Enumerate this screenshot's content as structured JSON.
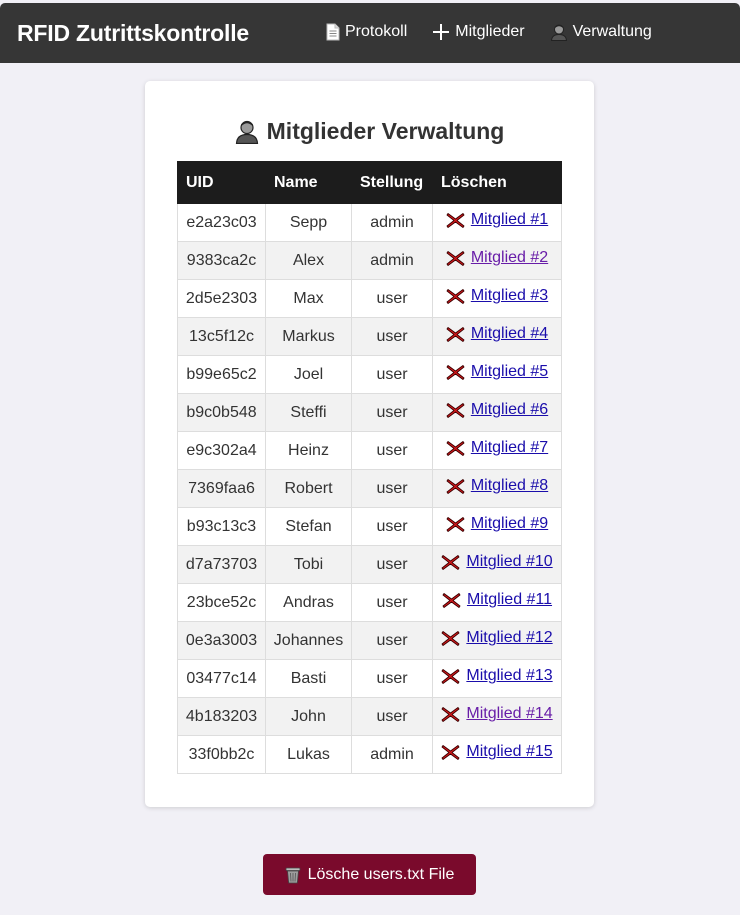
{
  "nav": {
    "brand": "RFID Zutrittskontrolle",
    "links": [
      {
        "label": "Protokoll",
        "icon": "document-icon"
      },
      {
        "label": "Mitglieder",
        "icon": "plus-icon"
      },
      {
        "label": "Verwaltung",
        "icon": "user-icon"
      }
    ]
  },
  "page": {
    "title": "Mitglieder Verwaltung",
    "title_icon": "user-icon"
  },
  "table": {
    "headers": [
      "UID",
      "Name",
      "Stellung",
      "Löschen"
    ],
    "rows": [
      {
        "uid": "e2a23c03",
        "name": "Sepp",
        "role": "admin",
        "delete": "Mitglied #1"
      },
      {
        "uid": "9383ca2c",
        "name": "Alex",
        "role": "admin",
        "delete": "Mitglied #2"
      },
      {
        "uid": "2d5e2303",
        "name": "Max",
        "role": "user",
        "delete": "Mitglied #3"
      },
      {
        "uid": "13c5f12c",
        "name": "Markus",
        "role": "user",
        "delete": "Mitglied #4"
      },
      {
        "uid": "b99e65c2",
        "name": "Joel",
        "role": "user",
        "delete": "Mitglied #5"
      },
      {
        "uid": "b9c0b548",
        "name": "Steffi",
        "role": "user",
        "delete": "Mitglied #6"
      },
      {
        "uid": "e9c302a4",
        "name": "Heinz",
        "role": "user",
        "delete": "Mitglied #7"
      },
      {
        "uid": "7369faa6",
        "name": "Robert",
        "role": "user",
        "delete": "Mitglied #8"
      },
      {
        "uid": "b93c13c3",
        "name": "Stefan",
        "role": "user",
        "delete": "Mitglied #9"
      },
      {
        "uid": "d7a73703",
        "name": "Tobi",
        "role": "user",
        "delete": "Mitglied #10"
      },
      {
        "uid": "23bce52c",
        "name": "Andras",
        "role": "user",
        "delete": "Mitglied #11"
      },
      {
        "uid": "0e3a3003",
        "name": "Johannes",
        "role": "user",
        "delete": "Mitglied #12"
      },
      {
        "uid": "03477c14",
        "name": "Basti",
        "role": "user",
        "delete": "Mitglied #13"
      },
      {
        "uid": "4b183203",
        "name": "John",
        "role": "user",
        "delete": "Mitglied #14"
      },
      {
        "uid": "33f0bb2c",
        "name": "Lukas",
        "role": "admin",
        "delete": "Mitglied #15"
      }
    ],
    "delete_icon": "cross-mark-icon"
  },
  "footer": {
    "delete_file_label": "Lösche users.txt File",
    "delete_file_icon": "trash-icon"
  },
  "colors": {
    "navbar": "#363636",
    "table_header": "#1c1c1c",
    "link": "#1a0dab",
    "link_visited": "#681da8",
    "danger_button": "#7a0a2c",
    "delete_cross": "#d7191c"
  }
}
